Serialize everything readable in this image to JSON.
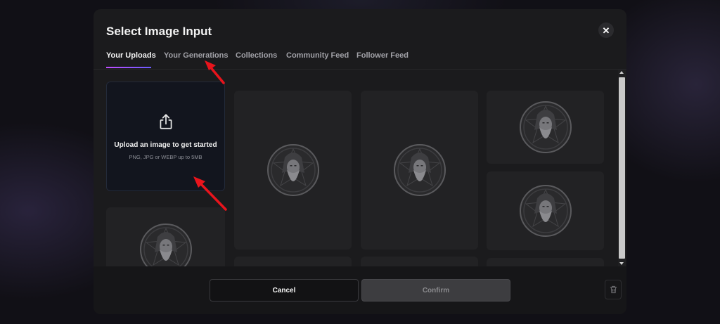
{
  "dialog": {
    "title": "Select Image Input",
    "close_icon": "close-icon"
  },
  "tabs": [
    {
      "label": "Your Uploads",
      "active": true
    },
    {
      "label": "Your Generations",
      "active": false
    },
    {
      "label": "Collections",
      "active": false
    },
    {
      "label": "Community Feed",
      "active": false
    },
    {
      "label": "Follower Feed",
      "active": false
    }
  ],
  "upload": {
    "icon": "upload-icon",
    "title": "Upload an image to get started",
    "hint": "PNG, JPG or WEBP up to 5MB"
  },
  "thumbnails": {
    "subject": "bearded-wizard-emblem",
    "count": 9
  },
  "footer": {
    "cancel_label": "Cancel",
    "confirm_label": "Confirm",
    "trash_icon": "trash-icon"
  },
  "colors": {
    "accent_gradient_start": "#c14dff",
    "accent_gradient_end": "#6b5cff",
    "annotation_arrow": "#e8141c"
  }
}
